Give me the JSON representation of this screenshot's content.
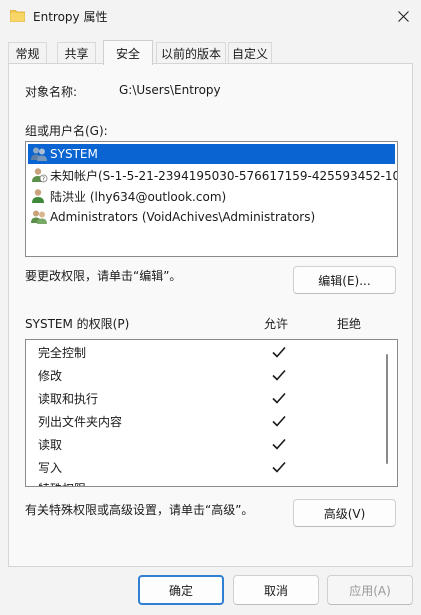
{
  "window": {
    "title": "Entropy 属性",
    "icon": "folder-icon"
  },
  "tabs": [
    {
      "label": "常规",
      "active": false
    },
    {
      "label": "共享",
      "active": false
    },
    {
      "label": "安全",
      "active": true
    },
    {
      "label": "以前的版本",
      "active": false
    },
    {
      "label": "自定义",
      "active": false
    }
  ],
  "security": {
    "object_name_label": "对象名称:",
    "object_name_value": "G:\\Users\\Entropy",
    "group_label": "组或用户名(G):",
    "users": [
      {
        "name": "SYSTEM",
        "icon": "group-users-icon",
        "selected": true
      },
      {
        "name": "未知帐户(S-1-5-21-2394195030-576617159-425593452-10...",
        "icon": "unknown-user-icon",
        "selected": false
      },
      {
        "name": "陆洪业 (lhy634@outlook.com)",
        "icon": "user-icon",
        "selected": false
      },
      {
        "name": "Administrators (VoidAchives\\Administrators)",
        "icon": "group-users-icon",
        "selected": false
      }
    ],
    "edit_hint": "要更改权限，请单击“编辑”。",
    "edit_button": "编辑(E)...",
    "perm_header": "SYSTEM 的权限(P)",
    "allow_header": "允许",
    "deny_header": "拒绝",
    "permissions": [
      {
        "name": "完全控制",
        "allow": true,
        "deny": false
      },
      {
        "name": "修改",
        "allow": true,
        "deny": false
      },
      {
        "name": "读取和执行",
        "allow": true,
        "deny": false
      },
      {
        "name": "列出文件夹内容",
        "allow": true,
        "deny": false
      },
      {
        "name": "读取",
        "allow": true,
        "deny": false
      },
      {
        "name": "写入",
        "allow": true,
        "deny": false
      },
      {
        "name": "特殊权限",
        "allow": false,
        "deny": false
      }
    ],
    "advanced_hint": "有关特殊权限或高级设置，请单击“高级”。",
    "advanced_button": "高级(V)"
  },
  "footer": {
    "ok": "确定",
    "cancel": "取消",
    "apply": "应用(A)"
  },
  "colors": {
    "selection": "#0a64d2",
    "primary_border": "#2f7fd3"
  }
}
